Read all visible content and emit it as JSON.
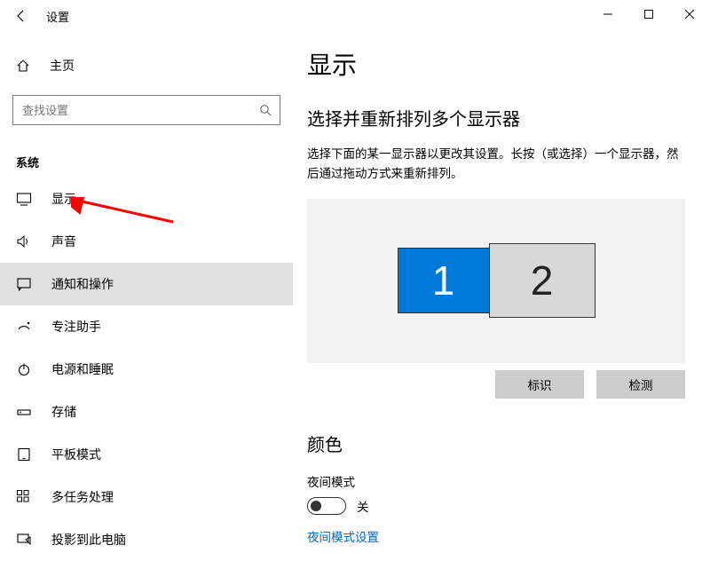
{
  "window": {
    "title": "设置"
  },
  "sidebar": {
    "home_label": "主页",
    "search_placeholder": "查找设置",
    "section_label": "系统",
    "items": [
      {
        "label": "显示",
        "icon": "display-icon",
        "selected": false
      },
      {
        "label": "声音",
        "icon": "sound-icon",
        "selected": false
      },
      {
        "label": "通知和操作",
        "icon": "notifications-icon",
        "selected": true
      },
      {
        "label": "专注助手",
        "icon": "focus-assist-icon",
        "selected": false
      },
      {
        "label": "电源和睡眠",
        "icon": "power-icon",
        "selected": false
      },
      {
        "label": "存储",
        "icon": "storage-icon",
        "selected": false
      },
      {
        "label": "平板模式",
        "icon": "tablet-mode-icon",
        "selected": false
      },
      {
        "label": "多任务处理",
        "icon": "multitasking-icon",
        "selected": false
      },
      {
        "label": "投影到此电脑",
        "icon": "project-icon",
        "selected": false
      }
    ]
  },
  "main": {
    "title": "显示",
    "arrange_heading": "选择并重新排列多个显示器",
    "arrange_desc": "选择下面的某一显示器以更改其设置。长按（或选择）一个显示器，然后通过拖动方式来重新排列。",
    "monitors": {
      "m1_label": "1",
      "m2_label": "2"
    },
    "identify_label": "标识",
    "detect_label": "检测",
    "color_heading": "颜色",
    "night_light_label": "夜间模式",
    "night_light_state": "关",
    "night_light_link": "夜间模式设置"
  }
}
